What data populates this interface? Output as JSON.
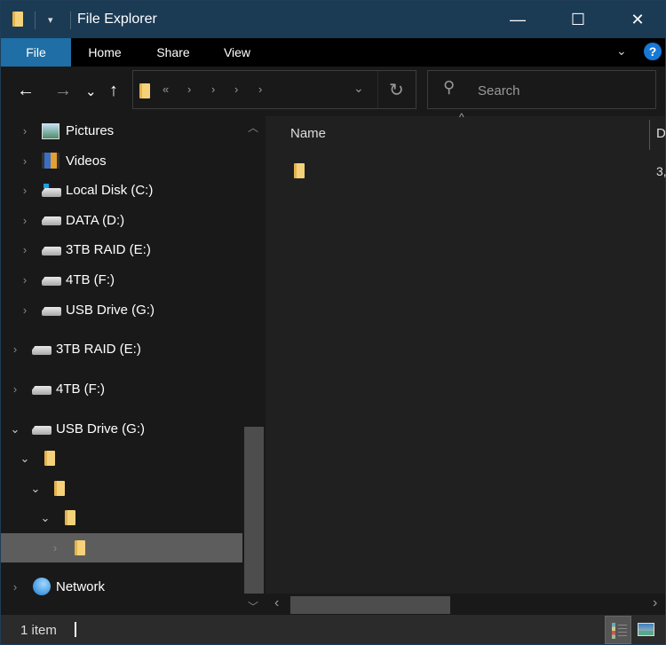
{
  "window": {
    "title": "File Explorer",
    "controls": {
      "minimize": "—",
      "maximize": "☐",
      "close": "✕"
    }
  },
  "ribbon": {
    "tabs": [
      {
        "label": "File",
        "active": true
      },
      {
        "label": "Home"
      },
      {
        "label": "Share"
      },
      {
        "label": "View"
      }
    ],
    "expand_icon": "⌄",
    "help_icon": "?"
  },
  "nav": {
    "back": "←",
    "forward": "→",
    "recent": "⌄",
    "up": "↑",
    "address": {
      "overflow": "«",
      "separators": [
        "›",
        "›",
        "›",
        "›"
      ],
      "dropdown": "⌄",
      "refresh": "↻"
    },
    "search": {
      "placeholder": "Search",
      "icon": "⚲"
    }
  },
  "tree": [
    {
      "label": "Pictures",
      "chevron": "›",
      "icon": "pictures"
    },
    {
      "label": "Videos",
      "chevron": "›",
      "icon": "videos"
    },
    {
      "label": "Local Disk (C:)",
      "chevron": "›",
      "icon": "system-drive"
    },
    {
      "label": "DATA (D:)",
      "chevron": "›",
      "icon": "drive-user"
    },
    {
      "label": "3TB RAID (E:)",
      "chevron": "›",
      "icon": "drive"
    },
    {
      "label": "4TB (F:)",
      "chevron": "›",
      "icon": "drive"
    },
    {
      "label": "USB Drive (G:)",
      "chevron": "›",
      "icon": "drive"
    },
    {
      "label": "3TB RAID (E:)",
      "chevron": "›",
      "icon": "drive"
    },
    {
      "label": "4TB (F:)",
      "chevron": "›",
      "icon": "drive"
    },
    {
      "label": "USB Drive (G:)",
      "chevron": "⌄",
      "icon": "drive"
    },
    {
      "label": "",
      "chevron": "⌄",
      "icon": "folder"
    },
    {
      "label": "",
      "chevron": "⌄",
      "icon": "folder"
    },
    {
      "label": "",
      "chevron": "⌄",
      "icon": "folder"
    },
    {
      "label": "",
      "chevron": "›",
      "icon": "folder",
      "selected": true
    },
    {
      "label": "Network",
      "chevron": "›",
      "icon": "network"
    }
  ],
  "content": {
    "columns": [
      {
        "label": "Name"
      },
      {
        "label": "D"
      }
    ],
    "sort_indicator": "^",
    "rows": [
      {
        "name": "",
        "icon": "folder",
        "second_col": "3,"
      }
    ]
  },
  "status": {
    "item_count": "1 item"
  }
}
